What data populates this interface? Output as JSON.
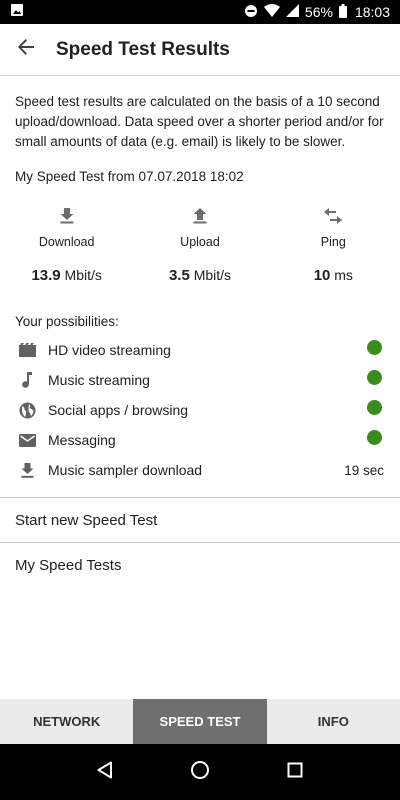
{
  "status_bar": {
    "battery_percent": "56%",
    "time": "18:03"
  },
  "header": {
    "title": "Speed Test Results"
  },
  "intro_text": "Speed test results are calculated on the basis of a 10 second upload/download. Data speed over a shorter period and/or for small amounts of data (e.g. email) is likely to be slower.",
  "test_from": "My Speed Test from 07.07.2018 18:02",
  "metrics": {
    "download": {
      "label": "Download",
      "value": "13.9",
      "unit": "Mbit/s"
    },
    "upload": {
      "label": "Upload",
      "value": "3.5",
      "unit": "Mbit/s"
    },
    "ping": {
      "label": "Ping",
      "value": "10",
      "unit": "ms"
    }
  },
  "possibilities": {
    "title": "Your possibilities:",
    "items": [
      {
        "label": "HD video streaming",
        "icon": "video-icon",
        "status": "ok"
      },
      {
        "label": "Music streaming",
        "icon": "music-note-icon",
        "status": "ok"
      },
      {
        "label": "Social apps / browsing",
        "icon": "globe-icon",
        "status": "ok"
      },
      {
        "label": "Messaging",
        "icon": "mail-icon",
        "status": "ok"
      },
      {
        "label": "Music sampler download",
        "icon": "download-icon",
        "status_text": "19 sec"
      }
    ]
  },
  "actions": {
    "start_new": "Start new Speed Test",
    "my_tests": "My Speed Tests"
  },
  "tabs": [
    {
      "label": "NETWORK",
      "active": false
    },
    {
      "label": "SPEED TEST",
      "active": true
    },
    {
      "label": "INFO",
      "active": false
    }
  ],
  "colors": {
    "status_ok": "#3a8d1a",
    "active_tab": "#6f6f6f",
    "tab_bar": "#ebebeb"
  }
}
